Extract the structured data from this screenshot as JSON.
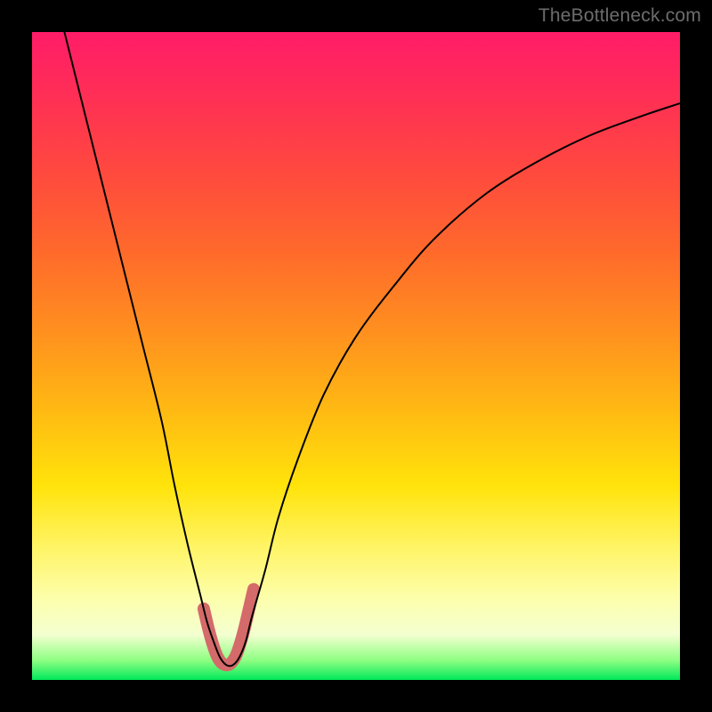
{
  "watermark": {
    "text": "TheBottleneck.com"
  },
  "chart_data": {
    "type": "line",
    "title": "",
    "xlabel": "",
    "ylabel": "",
    "xlim": [
      0,
      100
    ],
    "ylim": [
      0,
      100
    ],
    "grid": false,
    "legend": false,
    "series": [
      {
        "name": "black-curve",
        "color": "#000000",
        "stroke_width": 2,
        "x": [
          5,
          8,
          11,
          14,
          17,
          20,
          22,
          24,
          26,
          27,
          28,
          29,
          30,
          31,
          32,
          33,
          34,
          36,
          38,
          41,
          45,
          50,
          56,
          62,
          70,
          78,
          86,
          94,
          100
        ],
        "y": [
          100,
          88,
          76,
          64,
          52,
          40,
          30,
          21,
          13,
          9,
          6,
          3.5,
          2.3,
          2.3,
          3.5,
          6,
          10,
          17,
          25,
          34,
          44,
          53,
          61,
          68,
          75,
          80,
          84,
          87,
          89
        ]
      },
      {
        "name": "marker-band",
        "color": "#d46a6a",
        "stroke_width": 14,
        "linecap": "round",
        "x": [
          26.5,
          27.2,
          27.9,
          28.6,
          29.3,
          30.0,
          30.7,
          31.4,
          32.1,
          32.8,
          33.5,
          34.2
        ],
        "y": [
          11,
          8,
          5.5,
          3.6,
          2.6,
          2.3,
          2.6,
          3.6,
          5.5,
          8,
          11,
          14
        ]
      }
    ],
    "annotations": []
  }
}
